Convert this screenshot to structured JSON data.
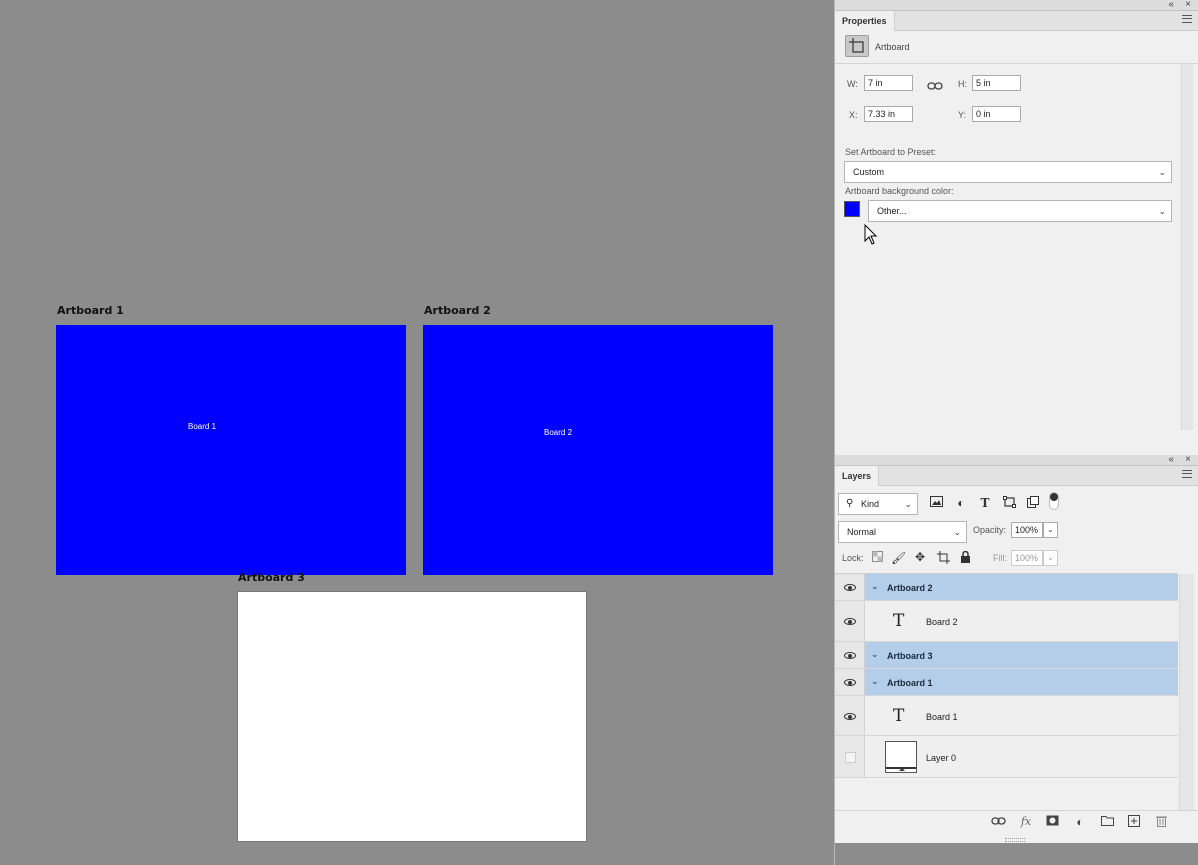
{
  "canvas": {
    "artboards": [
      {
        "label": "Artboard 1",
        "text": "Board 1",
        "bg": "#0000ff"
      },
      {
        "label": "Artboard 2",
        "text": "Board 2",
        "bg": "#0000ff"
      },
      {
        "label": "Artboard 3",
        "text": "",
        "bg": "#ffffff"
      }
    ]
  },
  "properties": {
    "tab": "Properties",
    "type_label": "Artboard",
    "w_label": "W:",
    "w_value": "7 in",
    "h_label": "H:",
    "h_value": "5 in",
    "x_label": "X:",
    "x_value": "7.33 in",
    "y_label": "Y:",
    "y_value": "0 in",
    "preset_label": "Set Artboard to Preset:",
    "preset_value": "Custom",
    "bg_color_label": "Artboard background color:",
    "bg_color_value": "Other...",
    "bg_swatch": "#0000ff"
  },
  "layers": {
    "tab": "Layers",
    "filter_kind": "Kind",
    "blend_mode": "Normal",
    "opacity_label": "Opacity:",
    "opacity_value": "100%",
    "lock_label": "Lock:",
    "fill_label": "Fill:",
    "fill_value": "100%",
    "items": [
      {
        "name": "Artboard 2",
        "type": "artboard",
        "visible": true
      },
      {
        "name": "Board 2",
        "type": "text",
        "visible": true
      },
      {
        "name": "Artboard 3",
        "type": "artboard",
        "visible": true
      },
      {
        "name": "Artboard 1",
        "type": "artboard",
        "visible": true
      },
      {
        "name": "Board 1",
        "type": "text",
        "visible": true
      },
      {
        "name": "Layer 0",
        "type": "pixel",
        "visible": false
      }
    ]
  },
  "colors": {
    "selection": "#b4cde8",
    "artboard_blue": "#0000ff"
  }
}
